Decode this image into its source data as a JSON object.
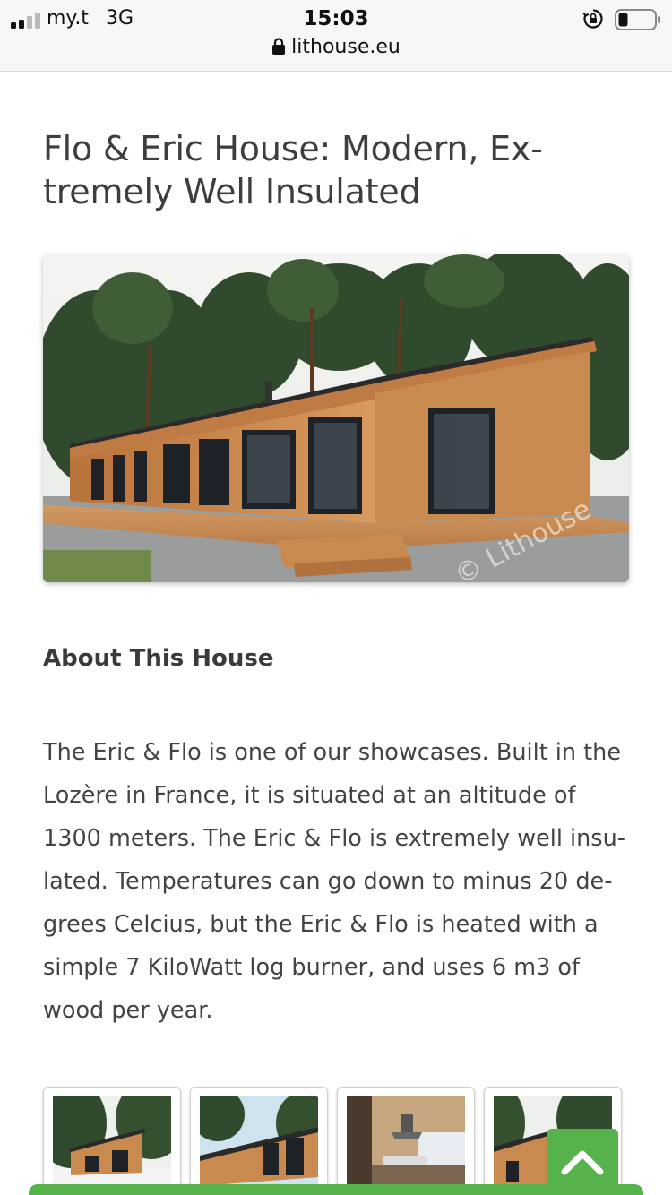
{
  "status_bar": {
    "carrier": "my.t",
    "network": "3G",
    "time": "15:03"
  },
  "browser": {
    "url": "lithouse.eu"
  },
  "page": {
    "title": "Flo & Eric House: Modern, Ex-tremely Well Insulated",
    "hero_watermark": "© Lithouse",
    "section_heading": "About This House",
    "description": "The Eric & Flo is one of our showcases. Built in the Lozère in France, it is situated at an altitude of 1300 meters. The Eric & Flo is extremely well insu-lated. Temperatures can go down to minus 20 de-grees Celcius, but the Eric & Flo is heated with a simple 7 KiloWatt log burner, and uses 6 m3 of wood per year."
  },
  "colors": {
    "accent": "#56b24a"
  },
  "icons": {
    "lock": "lock-icon",
    "back_to_top": "chevron-up-icon"
  }
}
